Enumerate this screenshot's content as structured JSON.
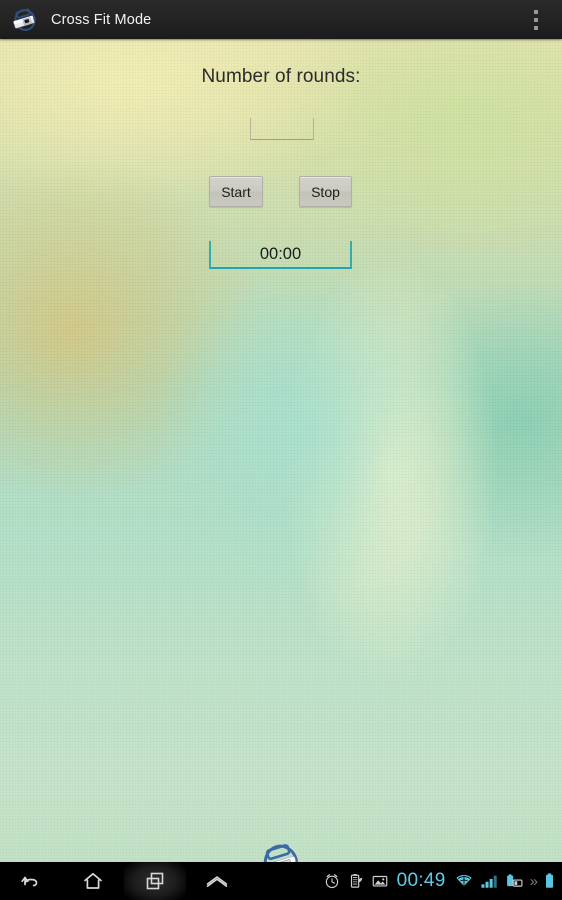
{
  "app": {
    "title": "Cross Fit Mode",
    "icon_name": "cross-fit-mode-app-icon",
    "overflow_menu_label": "More options"
  },
  "screen": {
    "heading": "Number of rounds:",
    "rounds_input": {
      "value": "",
      "placeholder": ""
    },
    "buttons": {
      "start": "Start",
      "stop": "Stop"
    },
    "timer": {
      "value": "00:00",
      "accent_color": "#1fa5ab"
    },
    "footer_logo_name": "cross-fit-mode-logo"
  },
  "navbar": {
    "back_label": "Back",
    "home_label": "Home",
    "recents_label": "Recent apps",
    "menu_label": "Menu"
  },
  "statusbar": {
    "time": "00:49",
    "time_color": "#63c8e6",
    "icons": [
      "alarm-clock-icon",
      "battery-saver-icon",
      "screenshot-icon",
      "wifi-icon",
      "cellular-signal-icon",
      "sim-battery-icon",
      "more-icons-chevron",
      "battery-icon"
    ],
    "chevrons": "»"
  },
  "theme": {
    "titlebar_bg": "#222222",
    "navbar_bg": "#000000",
    "text_color": "#2b2b2b",
    "button_bg": "#cbcbc3",
    "wallpaper_top": "#ece7b2",
    "wallpaper_bottom": "#c2e2c6"
  }
}
